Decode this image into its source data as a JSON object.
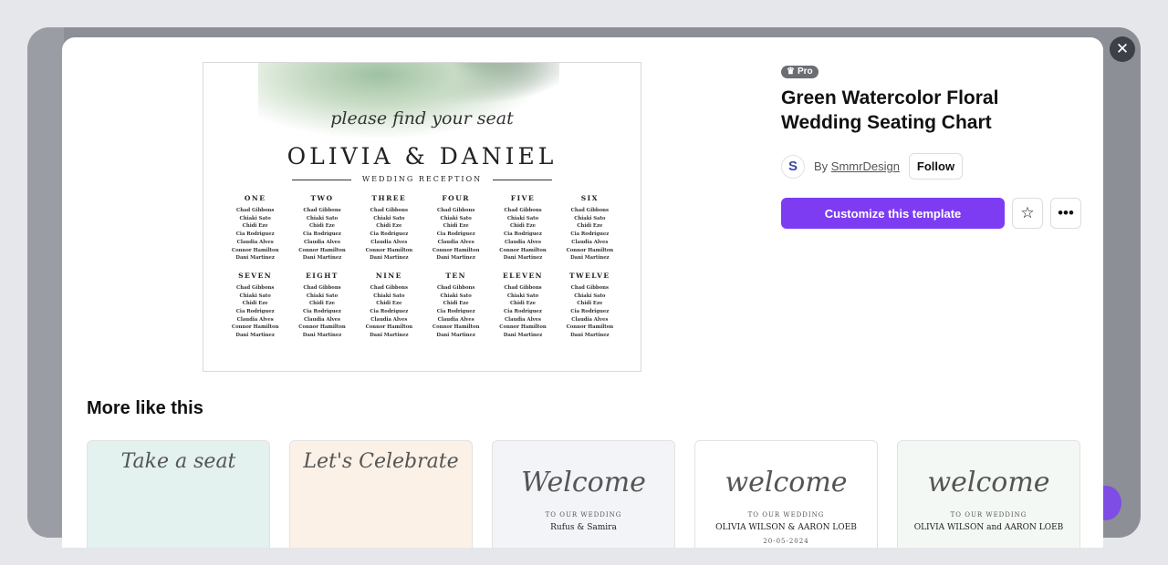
{
  "modal": {
    "close_icon": "close-icon"
  },
  "preview": {
    "script": "please find your seat",
    "couple": "OLIVIA & DANIEL",
    "subtitle": "WEDDING RECEPTION",
    "tables": [
      "ONE",
      "TWO",
      "THREE",
      "FOUR",
      "FIVE",
      "SIX",
      "SEVEN",
      "EIGHT",
      "NINE",
      "TEN",
      "ELEVEN",
      "TWELVE"
    ],
    "guests": [
      "Chad Gibbons",
      "Chiaki Sato",
      "Chidi Eze",
      "Cia Rodriguez",
      "Claudia Alves",
      "Connor Hamilton",
      "Dani Martinez"
    ]
  },
  "details": {
    "badge": "Pro",
    "badge_icon": "crown-icon",
    "title": "Green Watercolor Floral Wedding Seating Chart",
    "by_label": "By",
    "author": "SmmrDesign",
    "follow": "Follow",
    "customize": "Customize this template",
    "favorite_icon": "star-icon",
    "more_icon": "ellipsis-icon",
    "accent": "#7d3cf2"
  },
  "more": {
    "heading": "More like this",
    "items": [
      {
        "main": "Take a seat",
        "sub": "",
        "sub2": "",
        "bg": "#e3f1ef"
      },
      {
        "main": "Let's Celebrate",
        "sub": "",
        "sub2": "",
        "bg": "#fbf1e7"
      },
      {
        "main": "Welcome",
        "sub": "TO OUR WEDDING",
        "sub2": "Rufus & Samira",
        "bg": "#f3f4f8"
      },
      {
        "main": "welcome",
        "sub": "TO OUR WEDDING",
        "sub2": "OLIVIA WILSON & AARON LOEB",
        "sub3": "20-05-2024",
        "bg": "#ffffff"
      },
      {
        "main": "welcome",
        "sub": "TO OUR WEDDING",
        "sub2": "OLIVIA WILSON and AARON LOEB",
        "bg": "#f4f8f5"
      }
    ]
  }
}
